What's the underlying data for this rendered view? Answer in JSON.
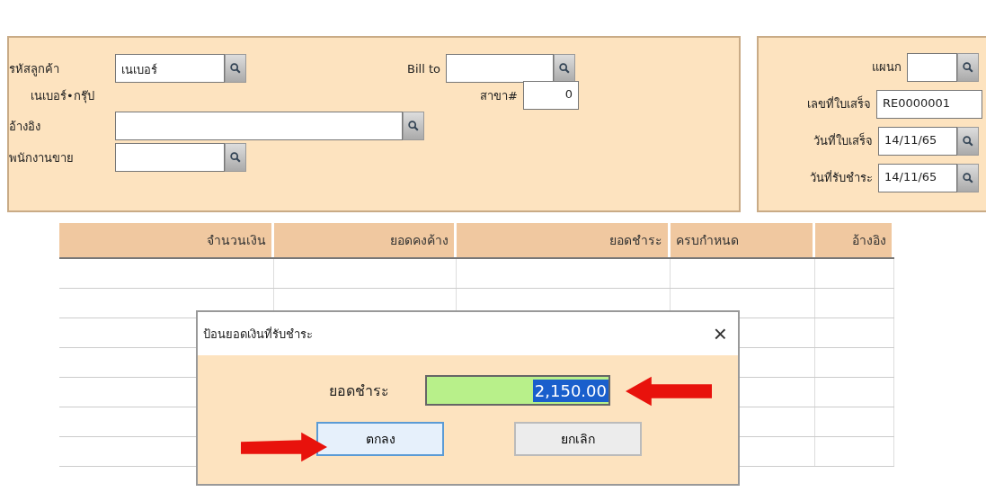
{
  "customer_panel": {
    "fields": [
      {
        "label": "รหัสลูกค้า",
        "value": "เนเบอร์",
        "kind": "lookup"
      },
      {
        "label": "Bill to",
        "kind": "lookup"
      },
      {
        "label": "สาขา#",
        "value": "0",
        "kind": "text"
      },
      {
        "label": "อ้างอิง",
        "kind": "lookup"
      },
      {
        "label": "พนักงานขาย",
        "kind": "lookup"
      }
    ],
    "customer_name": "เนเบอร์•กรุ๊ป"
  },
  "receipt_panel": {
    "fields": [
      {
        "label": "แผนก",
        "kind": "lookup"
      },
      {
        "label": "เลขที่ใบเสร็จ",
        "value": "RE0000001",
        "kind": "text"
      },
      {
        "label": "วันที่ใบเสร็จ",
        "value": "14/11/65",
        "kind": "lookup"
      },
      {
        "label": "วันที่รับชำระ",
        "value": "14/11/65",
        "kind": "lookup"
      }
    ]
  },
  "table": {
    "columns": [
      "จำนวนเงิน",
      "ยอดคงค้าง",
      "ยอดชำระ",
      "ครบกำหนด",
      "อ้างอิง"
    ]
  },
  "dialog": {
    "title": "ป้อนยอดเงินที่รับชำระ",
    "close": "×",
    "label": "ยอดชำระ",
    "value": "2,150.00",
    "value_selected": true,
    "buttons": [
      {
        "label": "ตกลง",
        "focused": true
      },
      {
        "label": "ยกเลิก",
        "focused": false
      }
    ]
  },
  "annotations": [
    {
      "kind": "arrow-left"
    },
    {
      "kind": "arrow-right"
    }
  ]
}
